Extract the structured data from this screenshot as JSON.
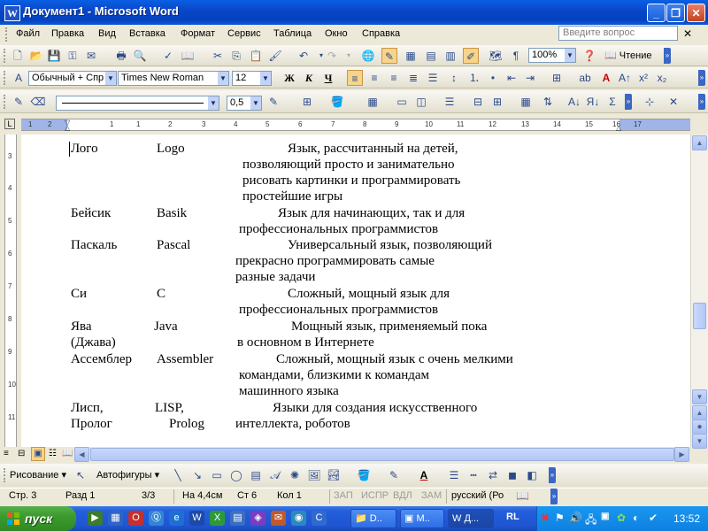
{
  "window": {
    "title": "Документ1 - Microsoft Word"
  },
  "menu": {
    "items": [
      "Файл",
      "Правка",
      "Вид",
      "Вставка",
      "Формат",
      "Сервис",
      "Таблица",
      "Окно",
      "Справка"
    ],
    "ask_placeholder": "Введите вопрос"
  },
  "toolbar_standard": {
    "zoom": "100%",
    "read_label": "Чтение"
  },
  "toolbar_format": {
    "style": "Обычный + Спр",
    "font": "Times New Roman",
    "size": "12"
  },
  "toolbar_tables": {
    "line_weight": "0,5"
  },
  "ruler": {
    "numbers": [
      "1",
      "2",
      "1",
      "1",
      "2",
      "3",
      "4",
      "5",
      "6",
      "7",
      "8",
      "9",
      "10",
      "11",
      "12",
      "13",
      "14",
      "15",
      "16",
      "17"
    ]
  },
  "vruler": {
    "numbers": [
      "3",
      "4",
      "5",
      "6",
      "7",
      "8",
      "9",
      "10",
      "11"
    ]
  },
  "document": {
    "rows": [
      {
        "ru": "Лого",
        "en": "Logo",
        "lines": [
          "Язык, рассчитанный на детей,",
          "позволяющий просто и занимательно",
          "рисовать картинки и программировать",
          "простейшие игры"
        ]
      },
      {
        "ru": "Бейсик",
        "en": "Basik",
        "lines": [
          "Язык для начинающих, так и для",
          "профессиональных программистов"
        ]
      },
      {
        "ru": "Паскаль",
        "en": "Pascal",
        "lines": [
          "Универсальный язык, позволяющий",
          "прекрасно программировать самые",
          "разные задачи"
        ]
      },
      {
        "ru": "Си",
        "en": "C",
        "lines": [
          "Сложный, мощный язык для",
          "профессиональных программистов"
        ]
      },
      {
        "ru": "Ява",
        "ru2": "(Джава)",
        "en": "Java",
        "lines": [
          "Мощный язык, применяемый пока",
          "в основном в Интернете"
        ]
      },
      {
        "ru": "Ассемблер",
        "en": "Assembler",
        "lines": [
          "Сложный, мощный язык с очень мелкими",
          "командами, близкими к командам",
          "машинного языка"
        ]
      },
      {
        "ru": "Лисп,",
        "ru2": "Пролог",
        "en": "LISP,",
        "en2": "Prolog",
        "lines": [
          "Языки для создания искусственного",
          "интеллекта, роботов"
        ]
      }
    ]
  },
  "drawing_toolbar": {
    "draw_label": "Рисование",
    "autoshapes_label": "Автофигуры"
  },
  "status": {
    "page": "Стр. 3",
    "section": "Разд 1",
    "pages": "3/3",
    "at": "На 4,4см",
    "line": "Ст 6",
    "col": "Кол 1",
    "rec": "ЗАП",
    "trk": "ИСПР",
    "ext": "ВДЛ",
    "ovr": "ЗАМ",
    "lang": "русский (Ро"
  },
  "taskbar": {
    "start_label": "пуск",
    "apps": [
      "D..",
      "M..",
      "Д..."
    ],
    "lang": "RL",
    "clock": "13:52"
  },
  "colors": {
    "titlebar": "#0a47c9",
    "taskbar": "#245edb",
    "start": "#3b9a2e",
    "tray": "#0f80e2",
    "highlight": "#f7d489"
  }
}
